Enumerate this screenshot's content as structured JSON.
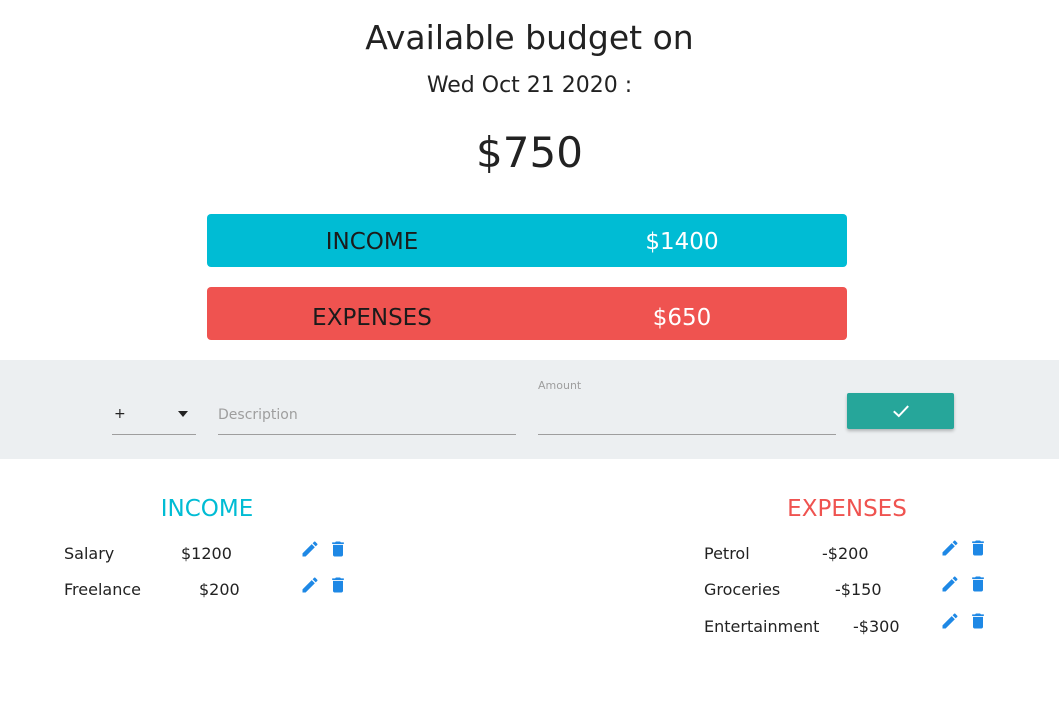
{
  "header": {
    "title": "Available budget on",
    "date": "Wed Oct 21 2020 :",
    "budget": "$750"
  },
  "summary": {
    "income_label": "INCOME",
    "income_value": "$1400",
    "expenses_label": "EXPENSES",
    "expenses_value": "$650"
  },
  "form": {
    "type_value": "+",
    "description_placeholder": "Description",
    "description_value": "",
    "amount_label": "Amount",
    "amount_value": "",
    "submit_icon": "check-icon"
  },
  "income": {
    "title": "INCOME",
    "items": [
      {
        "name": "Salary",
        "amount": "$1200"
      },
      {
        "name": "Freelance",
        "amount": "$200"
      }
    ]
  },
  "expenses": {
    "title": "EXPENSES",
    "items": [
      {
        "name": "Petrol",
        "amount": "-$200"
      },
      {
        "name": "Groceries",
        "amount": "-$150"
      },
      {
        "name": "Entertainment",
        "amount": "-$300"
      }
    ]
  },
  "icons": {
    "edit": "pencil-icon",
    "delete": "trash-icon"
  },
  "colors": {
    "income": "#00bcd4",
    "expenses": "#ef5350",
    "submit": "#26a69a",
    "action_icons": "#1e88e5",
    "form_band": "#eceff1"
  }
}
